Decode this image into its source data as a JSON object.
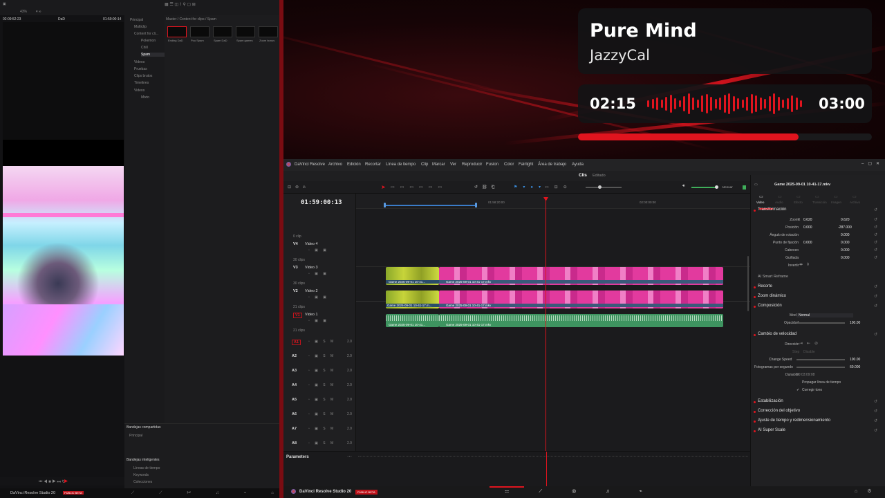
{
  "music": {
    "title": "Pure Mind",
    "artist": "JazzyCal",
    "elapsed": "02:15",
    "total": "03:00",
    "progress": 0.75,
    "accent": "#e0141e"
  },
  "left_app": {
    "zoom": "43%",
    "timecode_left": "02:09:52:23",
    "clip_name": "DaD",
    "timecode_right": "01:59:00:14",
    "breadcrumb": "Master / Content for clips / Spam",
    "bins": [
      "Principal",
      "Multiclip",
      "Content for cli...",
      "Pokemon",
      "Chill",
      "Spam",
      "Videos",
      "Pruebas",
      "Clips brutos",
      "Timelines",
      "Videos",
      "Mixto"
    ],
    "thumbs": [
      "Ending DaD",
      "Pou Spam",
      "Spam DaD",
      "Spam games",
      "Zoom bonus"
    ],
    "shared_bins_title": "Bandejas compartidas",
    "shared_bins": [
      "Principal"
    ],
    "smart_bins_title": "Bandejas inteligentes",
    "smart_bins": [
      "Líneas de tiempo",
      "Keywords",
      "Colecciones"
    ],
    "app_name": "DaVinci Resolve Studio 20",
    "badge": "PUBLIC BETA"
  },
  "resolve": {
    "app_title": "DaVinci Resolve",
    "menu": [
      "Archivo",
      "Edición",
      "Recortar",
      "Línea de tiempo",
      "Clip",
      "Marcar",
      "Ver",
      "Reproducir",
      "Fusion",
      "Color",
      "Fairlight",
      "Área de trabajo",
      "Ayuda"
    ],
    "tab_clips": "Clis",
    "tab_edited": "Editado",
    "atenuar": "Atenuar",
    "timecode": "01:59:00:13",
    "ruler": [
      "01:58:20:00",
      "02:00:00:00"
    ],
    "video_tracks": [
      {
        "id": "V4",
        "name": "Video 4",
        "clips": "0 clip"
      },
      {
        "id": "V3",
        "name": "Video 3",
        "clips": "30 clips"
      },
      {
        "id": "V2",
        "name": "Video 2",
        "clips": "30 clips"
      },
      {
        "id": "V1",
        "name": "Video 1",
        "clips": "21 clips"
      }
    ],
    "v1_clips_below": "21 clips",
    "audio_tracks": [
      {
        "id": "A1",
        "level": "2.0"
      },
      {
        "id": "A2",
        "level": "2.0"
      },
      {
        "id": "A3",
        "level": "2.0"
      },
      {
        "id": "A4",
        "level": "2.0"
      },
      {
        "id": "A5",
        "level": "2.0"
      },
      {
        "id": "A6",
        "level": "2.0"
      },
      {
        "id": "A7",
        "level": "2.0"
      },
      {
        "id": "A8",
        "level": "2.0"
      }
    ],
    "clip_short": "Game 2025-09-01 10-41...",
    "clip_long": "Game 2025-09-01 10-41-17.mkv",
    "clip_short_v1": "Game 2025-09-01 10-41-17.m...",
    "parameters": "Parameters",
    "app_name": "DaVinci Resolve Studio 20",
    "badge": "PUBLIC BETA",
    "inspector": {
      "file": "Game 2025-09-01 10-41-17.mkv",
      "tabs": [
        "Video",
        "Audio",
        "Efecto",
        "Transición",
        "Imagen",
        "Archivo"
      ],
      "transform": "Transformación",
      "zoom_label": "Zoom",
      "zoom_x": "0.620",
      "zoom_y": "0.620",
      "pos_label": "Posición",
      "pos_x": "0.000",
      "pos_y": "-287.000",
      "rot_label": "Ángulo de rotación",
      "rot": "0.000",
      "anchor_label": "Punto de fijación",
      "anchor_x": "0.000",
      "anchor_y": "0.000",
      "pitch_label": "Cabeceo",
      "pitch": "0.000",
      "yaw_label": "Guiñada",
      "yaw": "0.000",
      "flip_label": "Invertir",
      "reframe": "AI Smart Reframe",
      "crop": "Recorte",
      "dynzoom": "Zoom dinámico",
      "composite": "Composición",
      "mode_label": "Modo",
      "mode": "Normal",
      "opacity_label": "Opacidad",
      "opacity": "100.00",
      "speed": "Cambio de velocidad",
      "direction_label": "Dirección",
      "step_label": "Step",
      "step": "Disable",
      "change_speed_label": "Change Speed",
      "change_speed": "100.00",
      "fps_label": "Fotogramas por segundo",
      "fps": "60.000",
      "duration_label": "Duración",
      "duration": "00:03:09:08",
      "ripple": "Propagar línea de tiempo",
      "pitch_correct": "Corregir tono",
      "stabilization": "Estabilización",
      "lens": "Corrección del objetivo",
      "retime": "Ajuste de tiempo y redimensionamiento",
      "superscale": "AI Super Scale"
    }
  }
}
